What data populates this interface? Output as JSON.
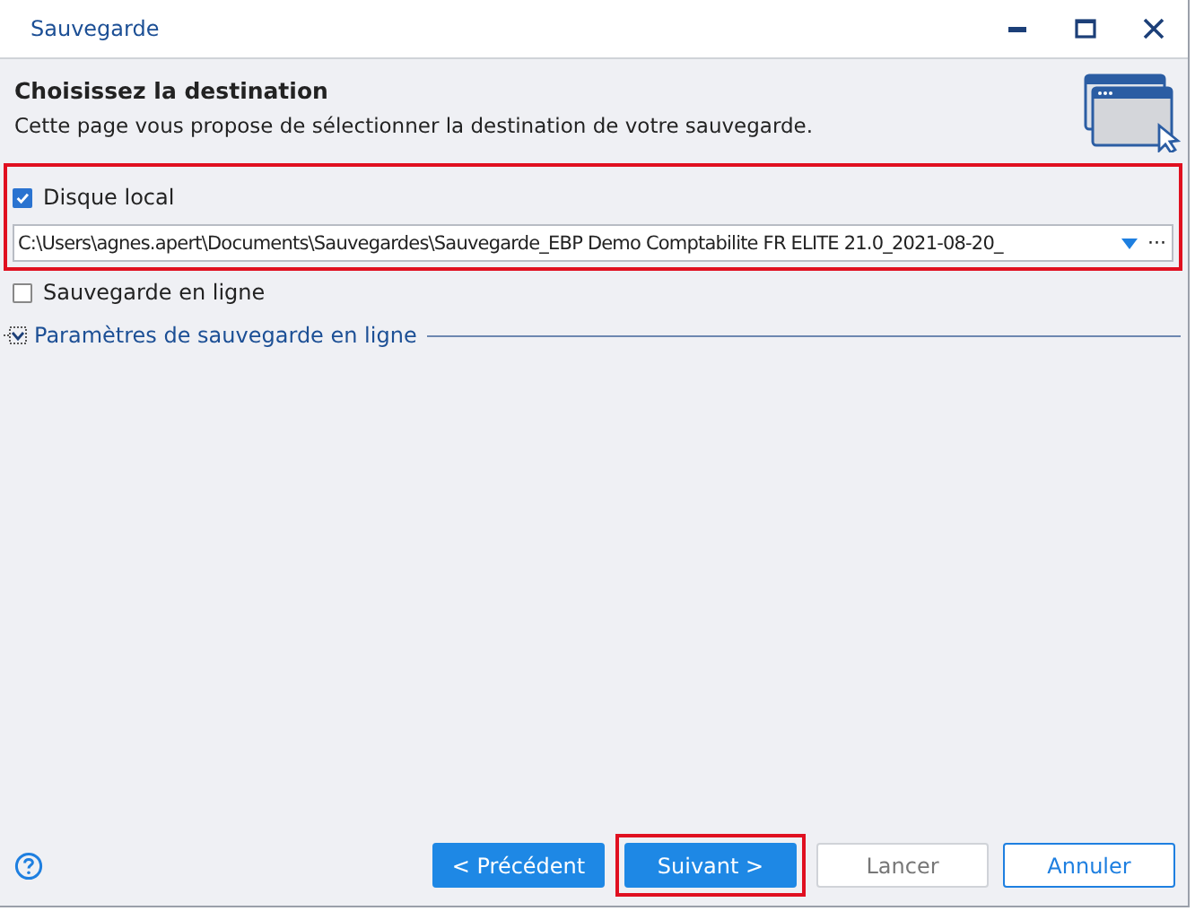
{
  "window": {
    "title": "Sauvegarde"
  },
  "header": {
    "title": "Choisissez la destination",
    "description": "Cette page vous propose de sélectionner la destination de votre sauvegarde."
  },
  "local": {
    "label": "Disque local",
    "checked": true,
    "highlighted": true,
    "path": "C:\\Users\\agnes.apert\\Documents\\Sauvegardes\\Sauvegarde_EBP Demo Comptabilite FR ELITE 21.0_2021-08-20_",
    "browse": "···"
  },
  "online": {
    "label": "Sauvegarde en ligne",
    "checked": false
  },
  "online_settings": {
    "label": "Paramètres de sauvegarde en ligne",
    "expanded": false
  },
  "buttons": [
    {
      "label": "< Précédent",
      "kind": "primary",
      "highlighted": false
    },
    {
      "label": "Suivant >",
      "kind": "primary",
      "highlighted": true
    },
    {
      "label": "Lancer",
      "kind": "disabled",
      "highlighted": false
    },
    {
      "label": "Annuler",
      "kind": "secondary",
      "highlighted": false
    }
  ]
}
